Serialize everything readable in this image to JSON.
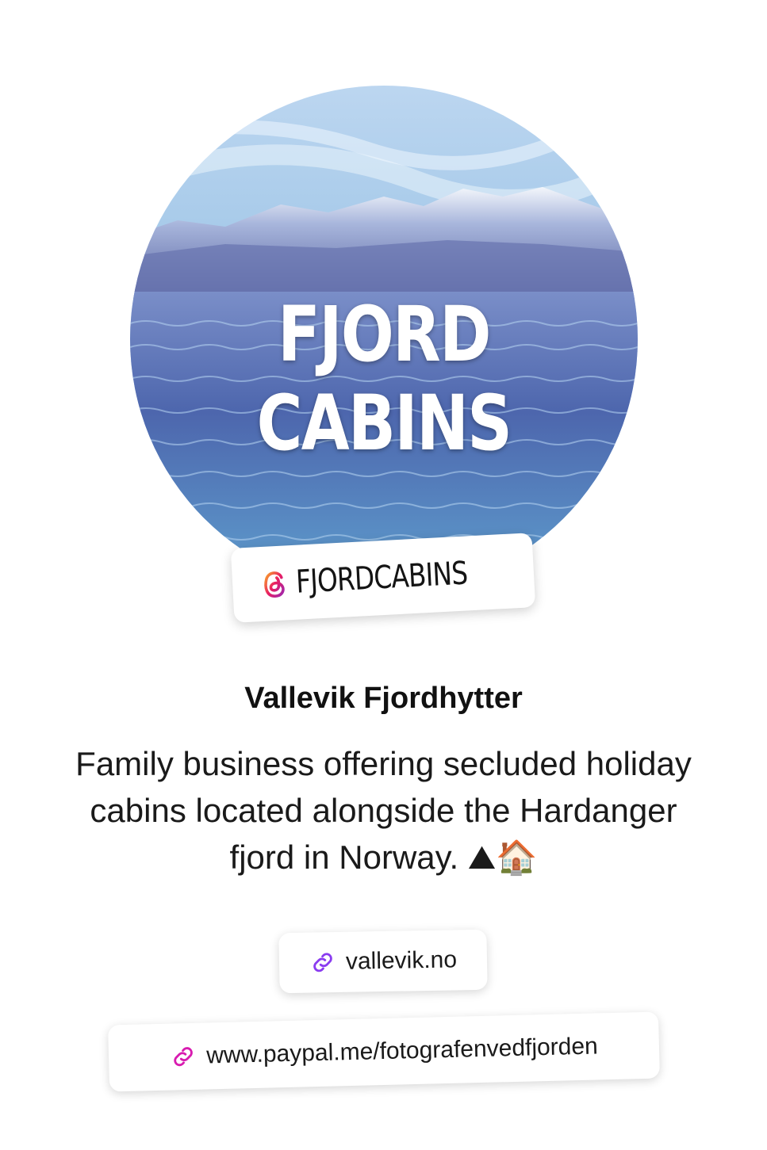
{
  "profile": {
    "avatar_text": "FJORD CABINS",
    "handle": "FJORDCABINS",
    "handle_icon": "threads-icon",
    "display_name": "Vallevik Fjordhytter",
    "bio": "Family business offering secluded holiday cabins located alongside the Hardanger fjord in Norway. ⛰🏠"
  },
  "links": [
    {
      "label": "vallevik.no",
      "icon": "link-icon",
      "icon_color": "#8a3cf0"
    },
    {
      "label": "www.paypal.me/fotografenvedfjorden",
      "icon": "link-icon",
      "icon_color": "#d81bb0"
    }
  ],
  "colors": {
    "threads_gradient": [
      "#f9a825",
      "#e91e63",
      "#9c27b0"
    ]
  }
}
